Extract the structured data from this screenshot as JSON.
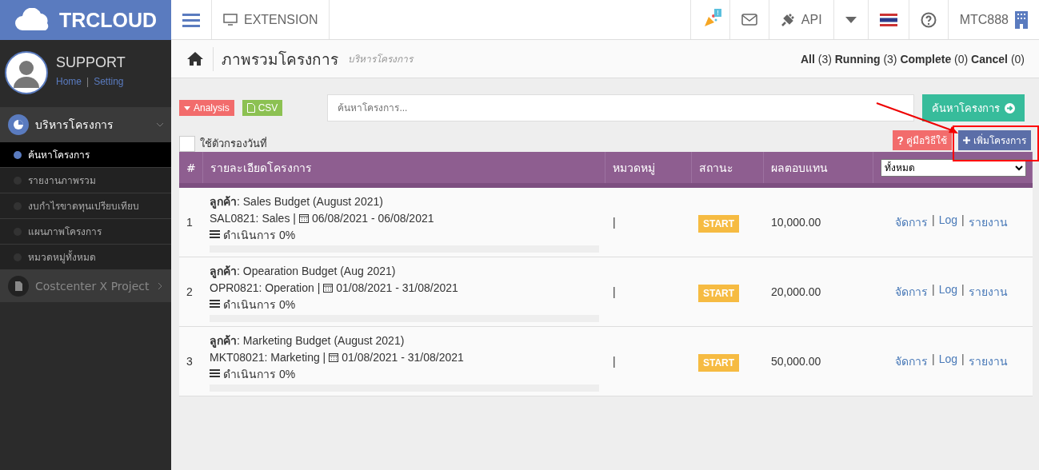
{
  "brand": {
    "name": "TRCLOUD"
  },
  "topbar": {
    "extension": "EXTENSION",
    "notification_badge": "!",
    "api": "API",
    "company": "MTC888"
  },
  "user": {
    "name": "SUPPORT",
    "links": [
      "Home",
      "|",
      "Setting"
    ]
  },
  "sidebar": {
    "items": [
      {
        "label": "บริหารโครงการ",
        "expanded": true,
        "children": [
          {
            "label": "ค้นหาโครงการ",
            "selected": true
          },
          {
            "label": "รายงานภาพรวม",
            "selected": false
          },
          {
            "label": "งบกำไรขาดทุนเปรียบเทียบ",
            "selected": false
          },
          {
            "label": "แผนภาพโครงการ",
            "selected": false
          },
          {
            "label": "หมวดหมู่ทั้งหมด",
            "selected": false
          }
        ]
      },
      {
        "label": "Costcenter X Project",
        "expanded": false
      }
    ]
  },
  "page": {
    "title": "ภาพรวมโครงการ",
    "subtitle": "บริหารโครงการ",
    "counts": "**All** (3) **Running** (3) **Complete** (0) **Cancel** (0)"
  },
  "toolbar": {
    "analysis": "Analysis",
    "csv": "CSV",
    "search": {
      "placeholder": "ค้นหาโครงการ..."
    },
    "search_button": "ค้นหาโครงการ",
    "date_filter": {
      "label": "ใช้ตัวกรองวันที่",
      "checked": false
    },
    "manual": "คู่มือวิธีใช้",
    "add": "เพิ่มโครงการ"
  },
  "table": {
    "columns": [
      "#",
      "รายละเอียดโครงการ",
      "หมวดหมู่",
      "สถานะ",
      "ผลตอบแทน"
    ],
    "filter": "ทั้งหมด",
    "rows": [
      {
        "no": "1",
        "customer": "**ลูกค้า**: Sales Budget (August 2021)",
        "code": "SAL0821: Sales |",
        "date": "06/08/2021 - 06/08/2021",
        "progress": "ดำเนินการ 0%",
        "level": 0,
        "category": "|",
        "status": "START",
        "amount": "10,000.00",
        "actions": [
          "จัดการ",
          "|",
          "Log",
          "|",
          "รายงาน"
        ]
      },
      {
        "no": "2",
        "customer": "**ลูกค้า**: Opearation Budget (Aug 2021)",
        "code": "OPR0821: Operation |",
        "date": "01/08/2021 - 31/08/2021",
        "progress": "ดำเนินการ 0%",
        "level": 0,
        "category": "|",
        "status": "START",
        "amount": "20,000.00",
        "actions": [
          "จัดการ",
          "|",
          "Log",
          "|",
          "รายงาน"
        ]
      },
      {
        "no": "3",
        "customer": "**ลูกค้า**: Marketing Budget (August 2021)",
        "code": "MKT08021: Marketing |",
        "date": "01/08/2021 - 31/08/2021",
        "progress": "ดำเนินการ 0%",
        "level": 0,
        "category": "|",
        "status": "START",
        "amount": "50,000.00",
        "actions": [
          "จัดการ",
          "|",
          "Log",
          "|",
          "รายงาน"
        ]
      }
    ]
  }
}
